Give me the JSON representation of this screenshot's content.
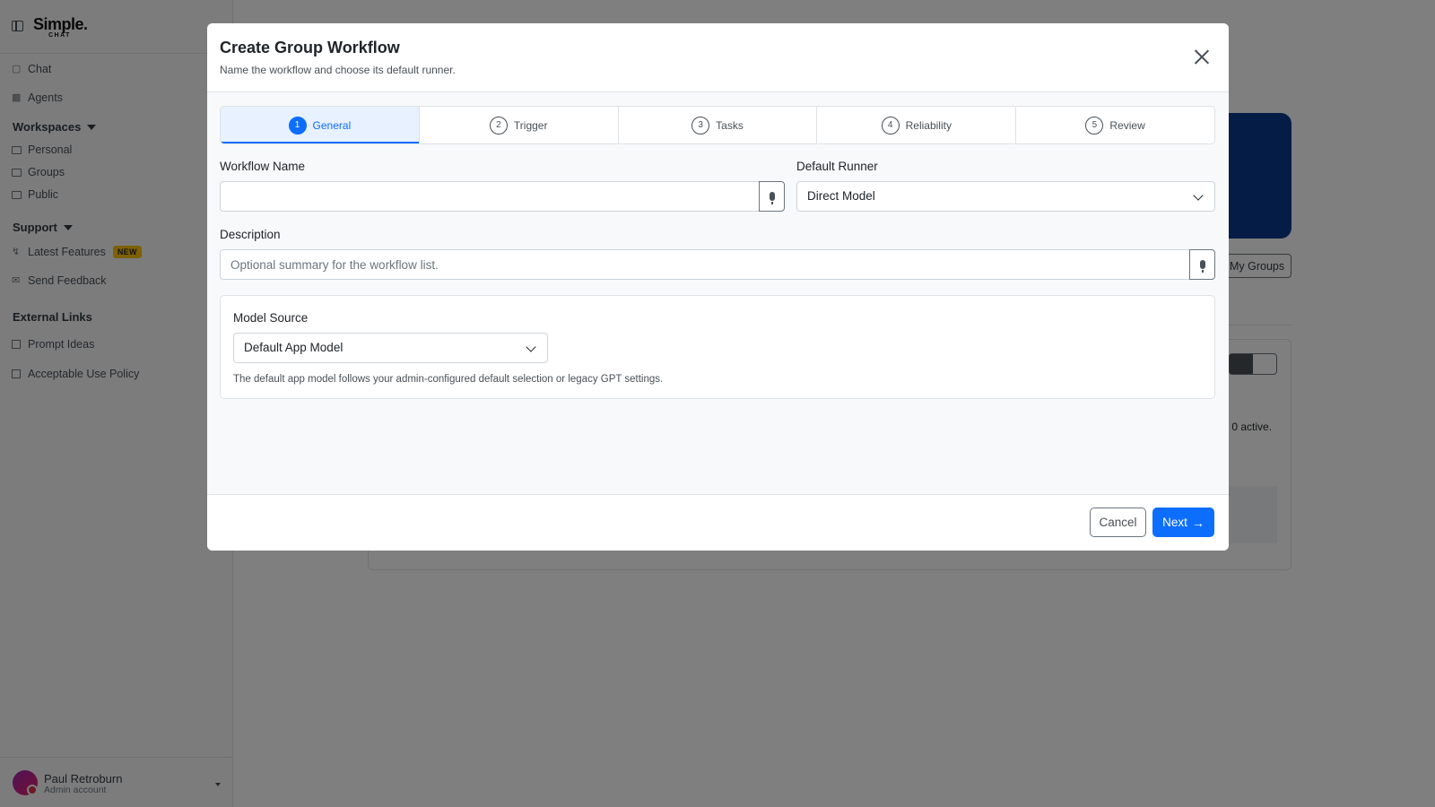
{
  "sidebar": {
    "logo_main": "Simple.",
    "logo_sub": "CHAT",
    "nav": [
      {
        "label": "Chat",
        "icon": "chat-icon"
      },
      {
        "label": "Agents",
        "icon": "robot-icon"
      }
    ],
    "workspaces_heading": "Workspaces",
    "workspaces": [
      {
        "label": "Personal",
        "icon": "folder-icon"
      },
      {
        "label": "Groups",
        "icon": "folder-icon"
      },
      {
        "label": "Public",
        "icon": "folder-icon"
      }
    ],
    "support_heading": "Support",
    "support": [
      {
        "label": "Latest Features",
        "icon": "lightning-icon",
        "badge": "NEW"
      },
      {
        "label": "Send Feedback",
        "icon": "envelope-icon"
      }
    ],
    "external_heading": "External Links",
    "external": [
      {
        "label": "Prompt Ideas",
        "icon": "external-link-icon"
      },
      {
        "label": "Acceptable Use Policy",
        "icon": "external-link-icon"
      }
    ],
    "user": {
      "name": "Paul Retroburn",
      "role": "Admin account"
    }
  },
  "background": {
    "my_groups_label": "My Groups",
    "status_text": "d, 0 active."
  },
  "modal": {
    "title": "Create Group Workflow",
    "subtitle": "Name the workflow and choose its default runner.",
    "steps": [
      {
        "num": "1",
        "label": "General"
      },
      {
        "num": "2",
        "label": "Trigger"
      },
      {
        "num": "3",
        "label": "Tasks"
      },
      {
        "num": "4",
        "label": "Reliability"
      },
      {
        "num": "5",
        "label": "Review"
      }
    ],
    "active_step": 1,
    "workflow_name_label": "Workflow Name",
    "workflow_name_value": "",
    "default_runner_label": "Default Runner",
    "default_runner_value": "Direct Model",
    "description_label": "Description",
    "description_placeholder": "Optional summary for the workflow list.",
    "model_source_label": "Model Source",
    "model_source_value": "Default App Model",
    "model_source_help": "The default app model follows your admin-configured default selection or legacy GPT settings.",
    "cancel_label": "Cancel",
    "next_label": "Next",
    "next_arrow": "→"
  },
  "colors": {
    "primary": "#0d6efd",
    "badge": "#ffc107",
    "overlay": "rgba(0,0,0,0.5)"
  }
}
